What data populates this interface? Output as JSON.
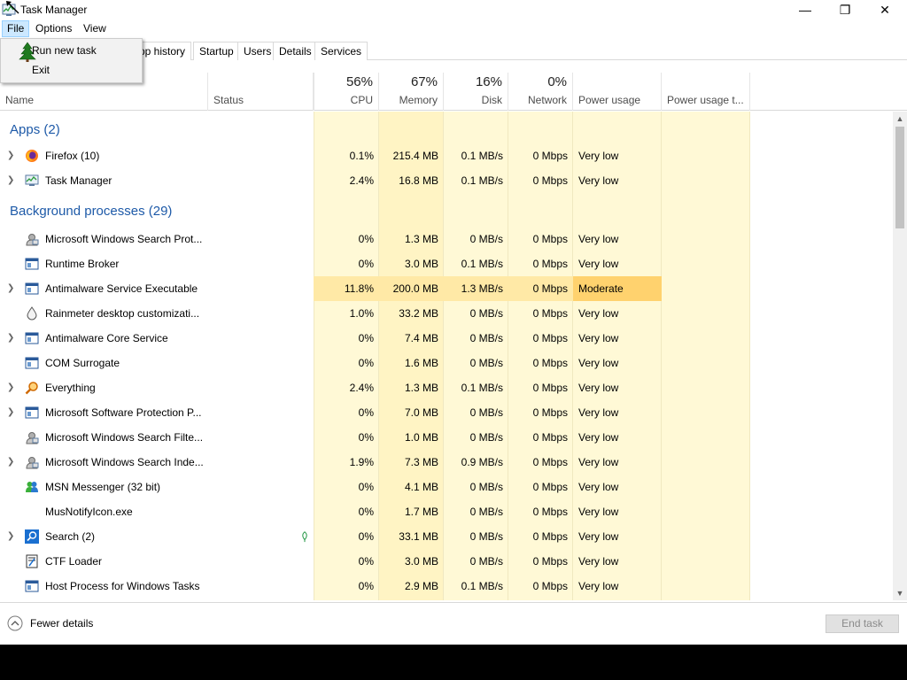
{
  "window": {
    "title": "Task Manager",
    "controls": {
      "minimize": "—",
      "maximize": "❐",
      "close": "✕"
    }
  },
  "menu": {
    "file": "File",
    "options": "Options",
    "view": "View"
  },
  "file_menu": {
    "run_new_task": "Run new task",
    "exit": "Exit"
  },
  "tabs": [
    "pp history",
    "Startup",
    "Users",
    "Details",
    "Services"
  ],
  "header": {
    "name": "Name",
    "status": "Status",
    "cpu": {
      "pct": "56%",
      "label": "CPU"
    },
    "memory": {
      "pct": "67%",
      "label": "Memory"
    },
    "disk": {
      "pct": "16%",
      "label": "Disk"
    },
    "network": {
      "pct": "0%",
      "label": "Network"
    },
    "power": "Power usage",
    "power_trend": "Power usage t..."
  },
  "groups": {
    "apps": "Apps (2)",
    "background": "Background processes (29)"
  },
  "apps": [
    {
      "name": "Firefox (10)",
      "icon": "firefox-icon",
      "expand": true,
      "cpu": "0.1%",
      "mem": "215.4 MB",
      "disk": "0.1 MB/s",
      "net": "0 Mbps",
      "power": "Very low"
    },
    {
      "name": "Task Manager",
      "icon": "task-manager-icon",
      "expand": true,
      "cpu": "2.4%",
      "mem": "16.8 MB",
      "disk": "0.1 MB/s",
      "net": "0 Mbps",
      "power": "Very low"
    }
  ],
  "background": [
    {
      "name": "Microsoft Windows Search Prot...",
      "icon": "user-service-icon",
      "expand": false,
      "cpu": "0%",
      "mem": "1.3 MB",
      "disk": "0 MB/s",
      "net": "0 Mbps",
      "power": "Very low"
    },
    {
      "name": "Runtime Broker",
      "icon": "window-app-icon",
      "expand": false,
      "cpu": "0%",
      "mem": "3.0 MB",
      "disk": "0.1 MB/s",
      "net": "0 Mbps",
      "power": "Very low"
    },
    {
      "name": "Antimalware Service Executable",
      "icon": "window-app-icon",
      "expand": true,
      "cpu": "11.8%",
      "mem": "200.0 MB",
      "disk": "1.3 MB/s",
      "net": "0 Mbps",
      "power": "Moderate",
      "highlight": true
    },
    {
      "name": "Rainmeter desktop customizati...",
      "icon": "rainmeter-drop-icon",
      "expand": false,
      "cpu": "1.0%",
      "mem": "33.2 MB",
      "disk": "0 MB/s",
      "net": "0 Mbps",
      "power": "Very low"
    },
    {
      "name": "Antimalware Core Service",
      "icon": "window-app-icon",
      "expand": true,
      "cpu": "0%",
      "mem": "7.4 MB",
      "disk": "0 MB/s",
      "net": "0 Mbps",
      "power": "Very low"
    },
    {
      "name": "COM Surrogate",
      "icon": "window-app-icon",
      "expand": false,
      "cpu": "0%",
      "mem": "1.6 MB",
      "disk": "0 MB/s",
      "net": "0 Mbps",
      "power": "Very low"
    },
    {
      "name": "Everything",
      "icon": "magnifier-icon",
      "expand": true,
      "cpu": "2.4%",
      "mem": "1.3 MB",
      "disk": "0.1 MB/s",
      "net": "0 Mbps",
      "power": "Very low"
    },
    {
      "name": "Microsoft Software Protection P...",
      "icon": "window-app-icon",
      "expand": true,
      "cpu": "0%",
      "mem": "7.0 MB",
      "disk": "0 MB/s",
      "net": "0 Mbps",
      "power": "Very low"
    },
    {
      "name": "Microsoft Windows Search Filte...",
      "icon": "user-service-icon",
      "expand": false,
      "cpu": "0%",
      "mem": "1.0 MB",
      "disk": "0 MB/s",
      "net": "0 Mbps",
      "power": "Very low"
    },
    {
      "name": "Microsoft Windows Search Inde...",
      "icon": "user-service-icon",
      "expand": true,
      "cpu": "1.9%",
      "mem": "7.3 MB",
      "disk": "0.9 MB/s",
      "net": "0 Mbps",
      "power": "Very low"
    },
    {
      "name": "MSN Messenger (32 bit)",
      "icon": "msn-messenger-icon",
      "expand": false,
      "cpu": "0%",
      "mem": "4.1 MB",
      "disk": "0 MB/s",
      "net": "0 Mbps",
      "power": "Very low"
    },
    {
      "name": "MusNotifyIcon.exe",
      "icon": "",
      "expand": false,
      "cpu": "0%",
      "mem": "1.7 MB",
      "disk": "0 MB/s",
      "net": "0 Mbps",
      "power": "Very low"
    },
    {
      "name": "Search (2)",
      "icon": "search-app-icon",
      "expand": true,
      "cpu": "0%",
      "mem": "33.1 MB",
      "disk": "0 MB/s",
      "net": "0 Mbps",
      "power": "Very low",
      "status_icon": "suspended-leaf-icon"
    },
    {
      "name": "CTF Loader",
      "icon": "ctf-loader-icon",
      "expand": false,
      "cpu": "0%",
      "mem": "3.0 MB",
      "disk": "0 MB/s",
      "net": "0 Mbps",
      "power": "Very low"
    },
    {
      "name": "Host Process for Windows Tasks",
      "icon": "window-app-icon",
      "expand": false,
      "cpu": "0%",
      "mem": "2.9 MB",
      "disk": "0.1 MB/s",
      "net": "0 Mbps",
      "power": "Very low"
    }
  ],
  "footer": {
    "fewer_details": "Fewer details",
    "end_task": "End task"
  },
  "colors": {
    "heat_light": "#fff9d6",
    "heat_mid": "#fff4c4",
    "heat_moderate": "#ffd26e",
    "group_title": "#1e5aa8"
  }
}
